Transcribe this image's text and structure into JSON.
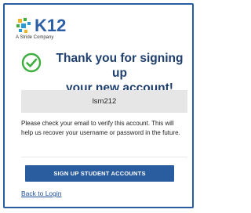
{
  "brand": {
    "logo_text": "K12",
    "tagline": "A Stride Company",
    "primary_color": "#2a5d9f",
    "accent_color": "#3fae3f",
    "icon": "k12-logo-icon"
  },
  "confirmation": {
    "icon": "check-circle-icon",
    "title_line1": "Thank you for signing up",
    "title_line2": "your new account!"
  },
  "username": {
    "value": "lsm212"
  },
  "message": {
    "text": "Please check your email to verify this account. This will help us recover your username or password in the future."
  },
  "actions": {
    "signup_students_label": "SIGN UP STUDENT ACCOUNTS",
    "back_to_login_label": "Back to Login"
  }
}
